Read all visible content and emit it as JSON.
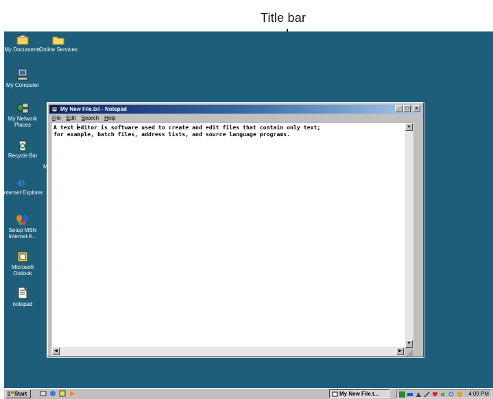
{
  "callout": {
    "label": "Title bar"
  },
  "desktop_icons": [
    {
      "label": "My Documents",
      "icon": "my-documents-icon"
    },
    {
      "label": "Online Services",
      "icon": "online-services-folder-icon"
    },
    {
      "label": "My Computer",
      "icon": "my-computer-icon"
    },
    {
      "label": "My Network Places",
      "icon": "network-places-icon"
    },
    {
      "label": "Recycle Bin",
      "icon": "recycle-bin-icon"
    },
    {
      "label": "Internet Explorer",
      "icon": "internet-explorer-icon"
    },
    {
      "label": "Setup MSN Internet A...",
      "icon": "msn-butterfly-icon"
    },
    {
      "label": "Microsoft Outlook",
      "icon": "outlook-icon"
    },
    {
      "label": "notepad",
      "icon": "notepad-shortcut-icon"
    }
  ],
  "desktop_partial_label": "M",
  "window": {
    "title": "My New File.txt - Notepad",
    "buttons": {
      "minimize": "_",
      "maximize": "□",
      "close": "x"
    },
    "menu": [
      "File",
      "Edit",
      "Search",
      "Help"
    ],
    "text_line1": "A text editor is software used to create and edit files that contain only text;",
    "text_line2": "for example, batch files, address lists, and source language programs."
  },
  "taskbar": {
    "start_label": "Start",
    "task_label": "My New File.t...",
    "clock": "4:09 PM"
  },
  "colors": {
    "desktop": "#1f5e7a",
    "title_active": "#0a246a",
    "title_gradient_end": "#a6caf0",
    "chrome": "#c0c0c0"
  }
}
